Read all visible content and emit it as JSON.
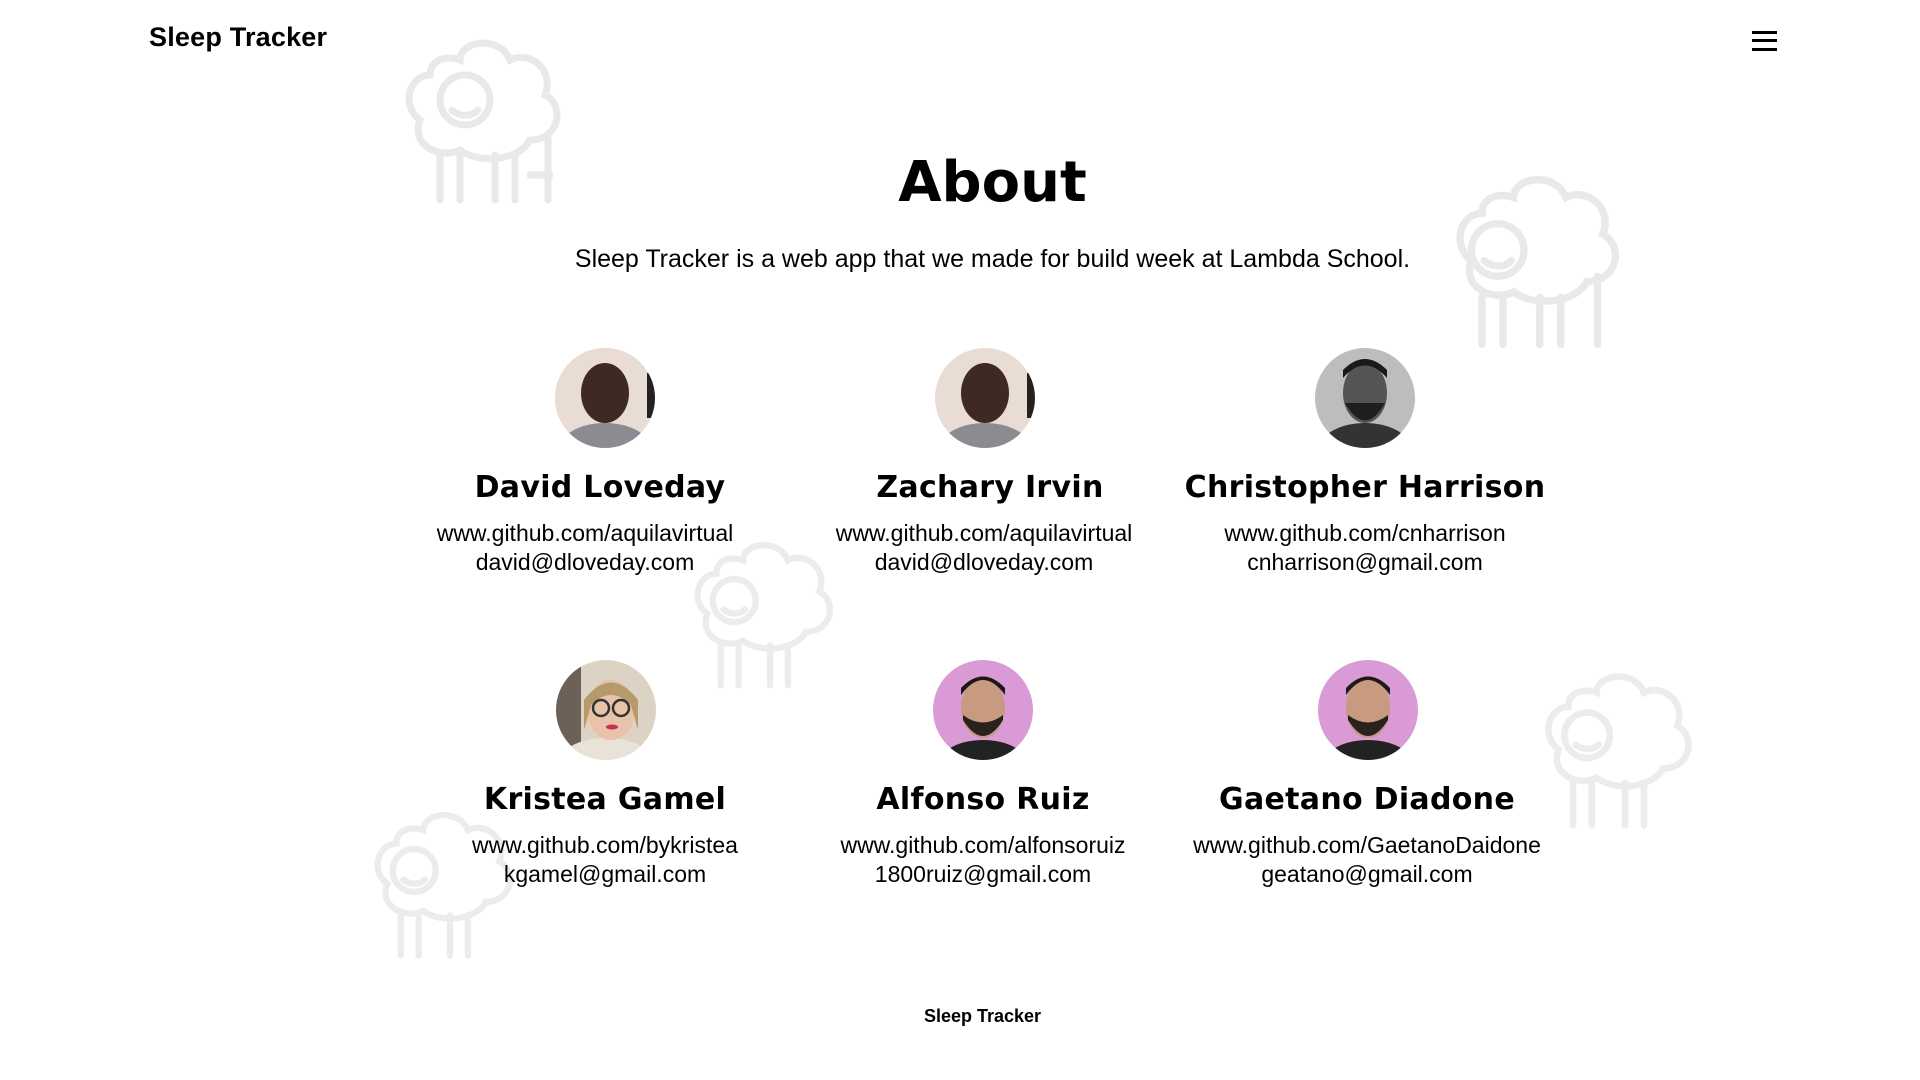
{
  "header": {
    "title": "Sleep Tracker",
    "menu_icon": "hamburger-menu-icon"
  },
  "about": {
    "title": "About",
    "description": "Sleep Tracker is a web app that we made for build week at Lambda School."
  },
  "members": [
    {
      "name": "David Loveday",
      "github": "www.github.com/aquilavirtual",
      "email": "david@dloveday.com"
    },
    {
      "name": "Zachary Irvin",
      "github": "www.github.com/aquilavirtual",
      "email": "david@dloveday.com"
    },
    {
      "name": "Christopher Harrison",
      "github": "www.github.com/cnharrison",
      "email": "cnharrison@gmail.com"
    },
    {
      "name": "Kristea Gamel",
      "github": "www.github.com/bykristea",
      "email": "kgamel@gmail.com"
    },
    {
      "name": "Alfonso Ruiz",
      "github": "www.github.com/alfonsoruiz",
      "email": "1800ruiz@gmail.com"
    },
    {
      "name": "Gaetano Diadone",
      "github": "www.github.com/GaetanoDaidone",
      "email": "geatano@gmail.com"
    }
  ],
  "footer": {
    "title": "Sleep Tracker"
  },
  "colors": {
    "background": "#ffffff",
    "text": "#000000",
    "sheep_outline": "#e9e9e9"
  }
}
